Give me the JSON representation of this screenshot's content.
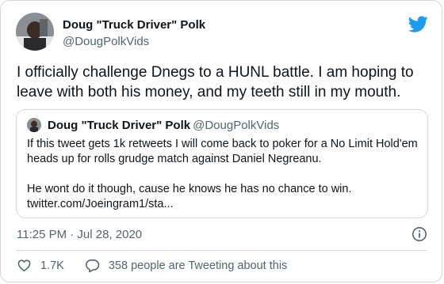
{
  "tweet": {
    "author_name": "Doug \"Truck Driver\" Polk",
    "author_handle": "@DougPolkVids",
    "text": "I officially challenge Dnegs to a HUNL battle. I am hoping to leave with both his money, and my teeth still in my mouth.",
    "timestamp": "11:25 PM · Jul 28, 2020",
    "likes": "1.7K",
    "conversation": "358 people are Tweeting about this"
  },
  "quoted": {
    "author_name": "Doug \"Truck Driver\" Polk",
    "author_handle": "@DougPolkVids",
    "text": "If this tweet gets 1k retweets I will come back to poker for a No Limit Hold'em heads up for rolls grudge match against Daniel Negreanu.\n\nHe wont do it though, cause he knows he has no chance to win.",
    "link": "twitter.com/Joeingram1/sta..."
  },
  "icons": {
    "brand": "twitter-bird-icon",
    "info": "info-icon",
    "like": "heart-icon",
    "reply": "reply-bubble-icon"
  },
  "colors": {
    "brand_blue": "#1d9bf0",
    "text_primary": "#0f1419",
    "text_secondary": "#536471",
    "border": "#cfd9de"
  }
}
